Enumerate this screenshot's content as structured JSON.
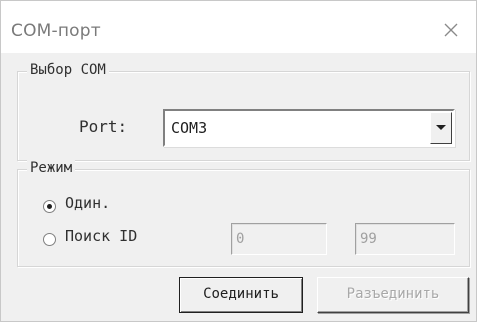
{
  "window": {
    "title": "COM-порт"
  },
  "com_group": {
    "legend": "Выбор COM",
    "port_label": "Port:",
    "port_value": "COM3"
  },
  "mode_group": {
    "legend": "Режим",
    "options": [
      {
        "label": "Один.",
        "checked": true
      },
      {
        "label": "Поиск ID",
        "checked": false
      }
    ],
    "range_from": "0",
    "range_to": "99"
  },
  "buttons": {
    "connect": "Соединить",
    "disconnect": "Разъединить"
  },
  "icons": {
    "close": "close-icon",
    "dropdown": "chevron-down-icon"
  },
  "colors": {
    "window_bg": "#f0f0f0",
    "titlebar_bg": "#ffffff",
    "disabled_text": "#a8a8a8"
  }
}
